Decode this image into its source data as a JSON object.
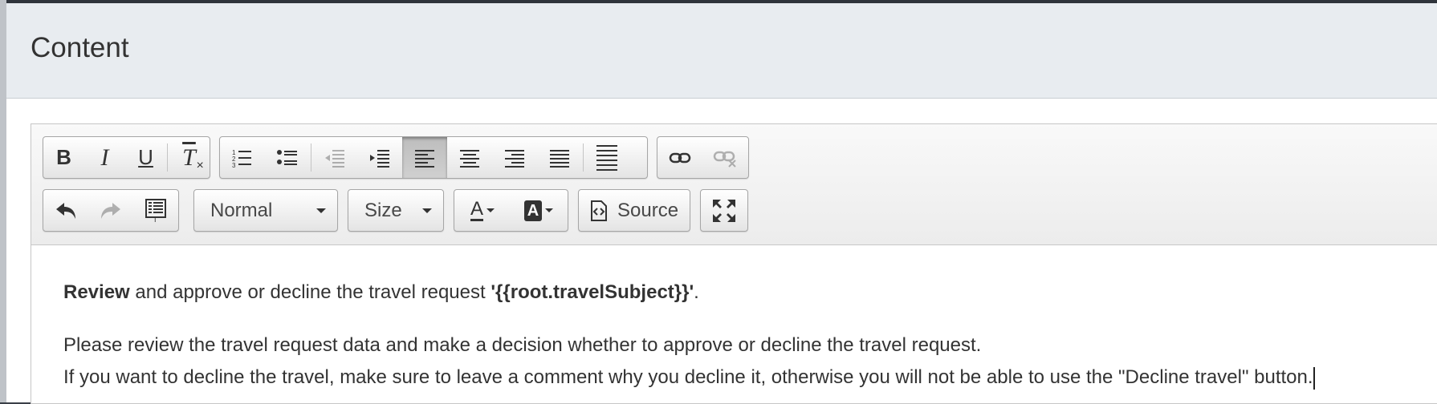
{
  "dialog": {
    "title": "Content"
  },
  "toolbar": {
    "bold_label": "B",
    "italic_label": "I",
    "underline_label": "U",
    "removeformat_label": "T",
    "format_value": "Normal",
    "size_value": "Size",
    "textcolor_label": "A",
    "bgcolor_label": "A",
    "source_label": "Source",
    "icons": [
      "bold-icon",
      "italic-icon",
      "underline-icon",
      "remove-format-icon",
      "numbered-list-icon",
      "bulleted-list-icon",
      "outdent-icon",
      "indent-icon",
      "align-left-icon",
      "align-center-icon",
      "align-right-icon",
      "justify-icon",
      "paragraph-format-icon",
      "link-icon",
      "unlink-icon",
      "undo-icon",
      "redo-icon",
      "paste-from-word-icon",
      "text-color-icon",
      "background-color-icon",
      "source-icon",
      "maximize-icon"
    ]
  },
  "content": {
    "line1_bold": "Review",
    "line1_text": " and approve or decline the travel request ",
    "line1_var": "'{{root.travelSubject}}'",
    "line1_end": ".",
    "line2": "Please review the travel request data and make a decision whether to approve or decline the travel request.",
    "line3": "If you want to decline the travel, make sure to leave a comment why you decline it, otherwise you will not be able to use the \"Decline travel\" button."
  },
  "colors": {
    "header_bg": "#e8ecf0",
    "toolbar_bg": "#f0f0f0",
    "text": "#333333"
  }
}
